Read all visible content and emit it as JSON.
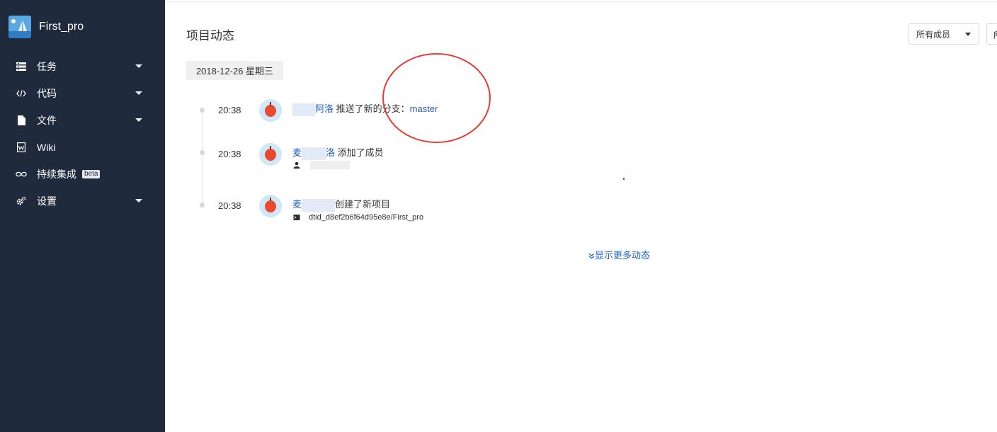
{
  "sidebar": {
    "project_name": "First_pro",
    "items": [
      {
        "label": "任务",
        "icon": "task-list-icon"
      },
      {
        "label": "代码",
        "icon": "code-icon"
      },
      {
        "label": "文件",
        "icon": "file-icon"
      },
      {
        "label": "Wiki",
        "icon": "wiki-icon"
      },
      {
        "label": "持续集成",
        "icon": "infinity-icon",
        "badge": "beta"
      },
      {
        "label": "设置",
        "icon": "gear-icon"
      }
    ]
  },
  "main": {
    "title": "项目动态",
    "filter_members": "所有成员",
    "filter_second": "所",
    "date": "2018-12-26 星期三",
    "activities": [
      {
        "time": "20:38",
        "user": "阿洛",
        "action": " 推送了新的分支：",
        "target": "master"
      },
      {
        "time": "20:38",
        "user": "麦",
        "user_tail": "洛",
        "action": " 添加了成员"
      },
      {
        "time": "20:38",
        "user": "麦",
        "action": "创建了新项目",
        "repo": "dtid_d8ef2b6f64d95e8e/First_pro"
      }
    ],
    "show_more": "显示更多动态"
  },
  "colors": {
    "sidebar_bg": "#1f2a3d",
    "link": "#1a62c5",
    "annotation": "#e53935"
  }
}
